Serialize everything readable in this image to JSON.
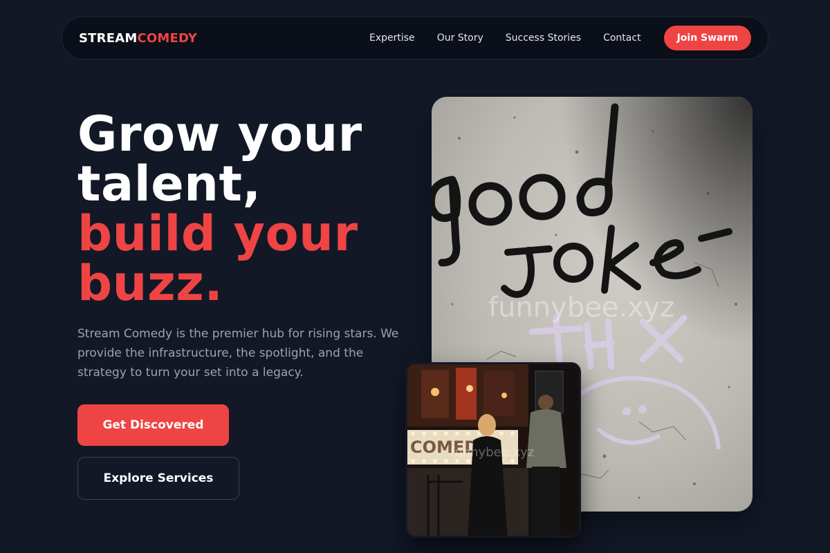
{
  "brand": {
    "part1": "STREAM",
    "part2": "COMEDY",
    "accent": "#ef4444"
  },
  "nav": {
    "links": [
      "Expertise",
      "Our Story",
      "Success Stories",
      "Contact"
    ],
    "cta": "Join Swarm"
  },
  "hero": {
    "headline_white": [
      "Grow your",
      "talent,"
    ],
    "headline_red": [
      "build your",
      "buzz."
    ],
    "lead": "Stream Comedy is the premier hub for rising stars. We provide the infrastructure, the spotlight, and the strategy to turn your set into a legacy.",
    "primary_button": "Get Discovered",
    "secondary_button": "Explore Services"
  },
  "images": {
    "main": {
      "graffiti_text": [
        "good",
        "joke",
        "THX"
      ],
      "watermark": "funnybee.xyz"
    },
    "small": {
      "sign_text": "COMEDY",
      "watermark": "funnybee.xyz"
    }
  },
  "colors": {
    "background": "#131827",
    "nav_background": "#0b0f19",
    "muted_text": "#9ca3af"
  }
}
